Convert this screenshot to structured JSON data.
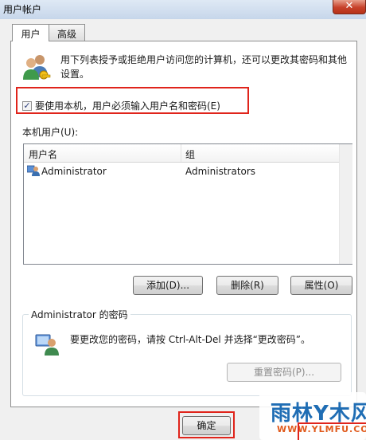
{
  "window": {
    "title": "用户帐户",
    "close_glyph": "✕"
  },
  "tabs": [
    {
      "label": "用户",
      "active": true
    },
    {
      "label": "高级",
      "active": false
    }
  ],
  "users_tab": {
    "description": "用下列表授予或拒绝用户访问您的计算机，还可以更改其密码和其他设置。",
    "require_login": {
      "label": "要使用本机，用户必须输入用户名和密码(E)",
      "checked": true,
      "check_glyph": "✓"
    },
    "list_label": "本机用户(U):",
    "columns": [
      "用户名",
      "组"
    ],
    "rows": [
      {
        "username": "Administrator",
        "group": "Administrators",
        "icon": "user-icon"
      }
    ],
    "buttons": {
      "add": "添加(D)...",
      "remove": "删除(R)",
      "properties": "属性(O)"
    },
    "password_group": {
      "title": "Administrator 的密码",
      "text": "要更改您的密码，请按 Ctrl-Alt-Del 并选择“更改密码”。",
      "reset_button": "重置密码(P)..."
    }
  },
  "footer": {
    "ok_button": "确定"
  },
  "watermark": {
    "main": "雨林Y木风",
    "url": "WWW.YLMFU.COM"
  },
  "colors": {
    "highlight": "#e0241b",
    "title_gradient": "#c6d6ea",
    "close": "#c7412a"
  }
}
